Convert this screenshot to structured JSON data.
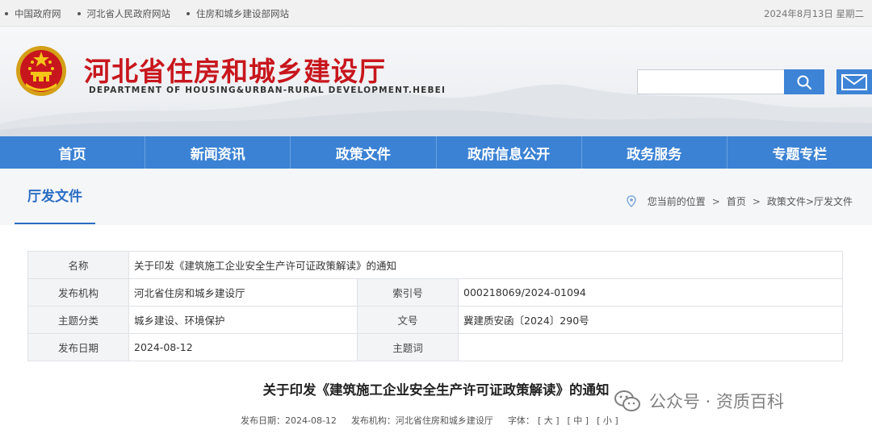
{
  "topbar": {
    "links": [
      "中国政府网",
      "河北省人民政府网站",
      "住房和城乡建设部网站"
    ],
    "date": "2024年8月13日 星期二"
  },
  "header": {
    "title": "河北省住房和城乡建设厅",
    "subtitle": "DEPARTMENT OF HOUSING&URBAN-RURAL DEVELOPMENT.HEBEI",
    "search_placeholder": ""
  },
  "nav": {
    "items": [
      "首页",
      "新闻资讯",
      "政策文件",
      "政府信息公开",
      "政务服务",
      "专题专栏"
    ]
  },
  "section": {
    "title": "厅发文件",
    "breadcrumb": {
      "prefix": "您当前的位置",
      "home": "首页",
      "path": "政策文件>厅发文件"
    }
  },
  "info": {
    "name_label": "名称",
    "name_value": "关于印发《建筑施工企业安全生产许可证政策解读》的通知",
    "publisher_label": "发布机构",
    "publisher_value": "河北省住房和城乡建设厅",
    "index_label": "索引号",
    "index_value": "000218069/2024-01094",
    "category_label": "主题分类",
    "category_value": "城乡建设、环境保护",
    "docno_label": "文号",
    "docno_value": "冀建质安函〔2024〕290号",
    "date_label": "发布日期",
    "date_value": "2024-08-12",
    "keyword_label": "主题词",
    "keyword_value": ""
  },
  "document": {
    "title": "关于印发《建筑施工企业安全生产许可证政策解读》的通知",
    "meta_date": "发布日期：2024-08-12",
    "meta_publisher": "发布机构：河北省住房和城乡建设厅",
    "font_label": "字体：",
    "font_large": "[ 大 ]",
    "font_medium": "[ 中 ]",
    "font_small": "[ 小 ]"
  },
  "watermark": {
    "text": "公众号 · 资质百科"
  },
  "colors": {
    "nav_blue": "#3b82d4",
    "title_red": "#c8161d",
    "section_blue": "#2a6ec4"
  }
}
